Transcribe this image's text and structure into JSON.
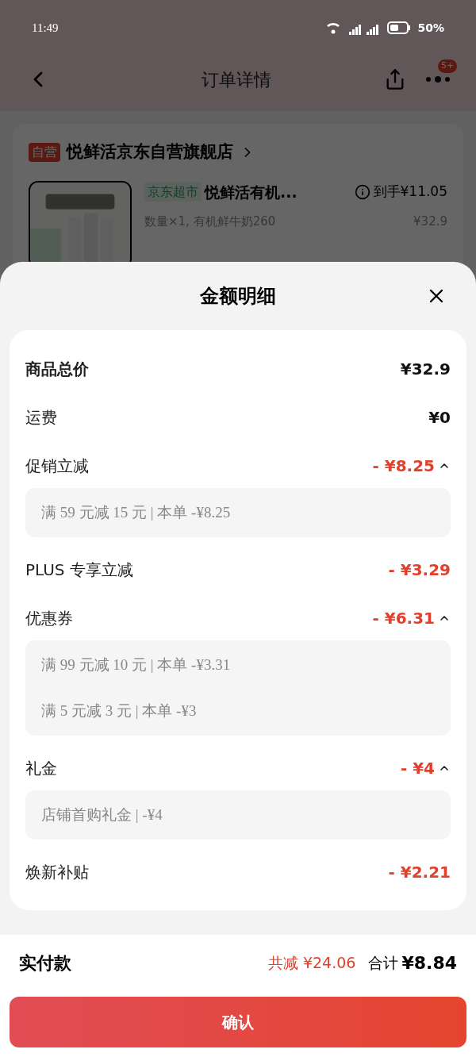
{
  "status_bar": {
    "time": "11:49",
    "battery": "50%"
  },
  "nav": {
    "title": "订单详情",
    "badge": "5+"
  },
  "store": {
    "tag": "自营",
    "name": "悦鲜活京东自营旗舰店"
  },
  "product": {
    "channel": "京东超市",
    "name": "悦鲜活有机...",
    "spec": "数量×1, 有机鲜牛奶260",
    "final_price": "到手¥11.05",
    "price": "¥32.9"
  },
  "sheet": {
    "title": "金额明细",
    "rows": [
      {
        "kind": "plain",
        "label": "商品总价",
        "value": "¥32.9",
        "bold": true
      },
      {
        "kind": "plain",
        "label": "运费",
        "value": "¥0",
        "bold": false
      },
      {
        "kind": "discount",
        "label": "促销立减",
        "value": "- ¥8.25",
        "expanded": true,
        "details": [
          "满 59 元减 15 元 | 本单 -¥8.25"
        ]
      },
      {
        "kind": "discount",
        "label": "PLUS 专享立减",
        "value": "- ¥3.29"
      },
      {
        "kind": "discount",
        "label": "优惠券",
        "value": "- ¥6.31",
        "expanded": true,
        "details": [
          "满 99 元减 10 元 | 本单 -¥3.31",
          "满 5 元减 3 元 | 本单 -¥3"
        ]
      },
      {
        "kind": "discount",
        "label": "礼金",
        "value": "- ¥4",
        "expanded": true,
        "details": [
          "店铺首购礼金 | -¥4"
        ]
      },
      {
        "kind": "discount",
        "label": "焕新补贴",
        "value": "- ¥2.21"
      }
    ]
  },
  "footer": {
    "label": "实付款",
    "saved": "共减 ¥24.06",
    "total_label": "合计",
    "total": "¥8.84",
    "button": "确认"
  }
}
